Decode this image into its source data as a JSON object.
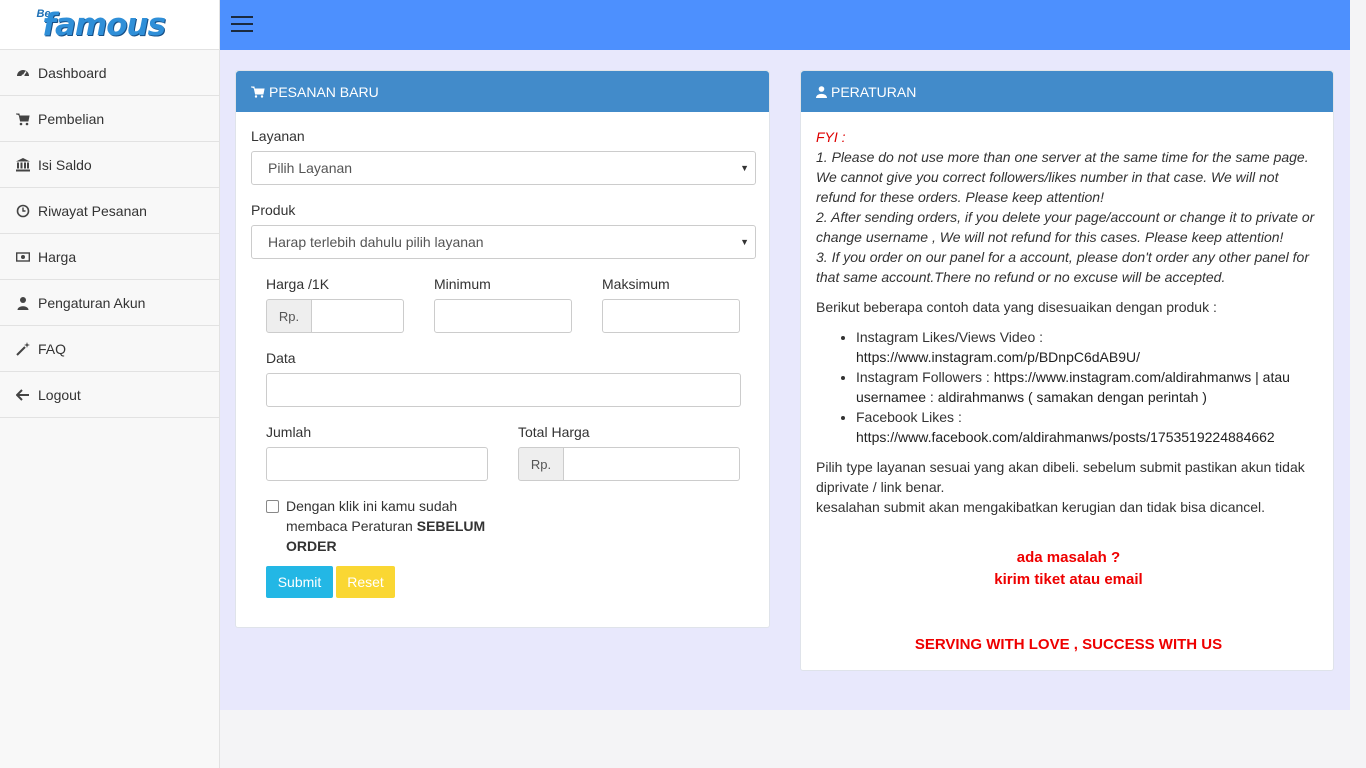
{
  "logo": {
    "small": "Be",
    "main": "famous"
  },
  "sidebar": {
    "items": [
      {
        "label": "Dashboard",
        "icon": "dashboard-icon"
      },
      {
        "label": "Pembelian",
        "icon": "cart-icon"
      },
      {
        "label": "Isi Saldo",
        "icon": "bank-icon"
      },
      {
        "label": "Riwayat Pesanan",
        "icon": "clock-icon"
      },
      {
        "label": "Harga",
        "icon": "money-icon"
      },
      {
        "label": "Pengaturan Akun",
        "icon": "user-icon"
      },
      {
        "label": "FAQ",
        "icon": "magic-wand-icon"
      },
      {
        "label": "Logout",
        "icon": "arrow-left-icon"
      }
    ]
  },
  "order_panel": {
    "title": "PESANAN BARU",
    "layanan_label": "Layanan",
    "layanan_value": "Pilih Layanan",
    "produk_label": "Produk",
    "produk_value": "Harap terlebih dahulu pilih layanan",
    "harga_label": "Harga /1K",
    "currency": "Rp.",
    "minimum_label": "Minimum",
    "maksimum_label": "Maksimum",
    "data_label": "Data",
    "jumlah_label": "Jumlah",
    "total_label": "Total Harga",
    "agree_text_1": "Dengan klik ini kamu sudah membaca Peraturan ",
    "agree_text_bold": "SEBELUM ORDER",
    "submit_label": "Submit",
    "reset_label": "Reset"
  },
  "rules_panel": {
    "title": "PERATURAN",
    "fyi_label": "FYI :",
    "fyi_1": "1. Please do not use more than one server at the same time for the same page. We cannot give you correct followers/likes number in that case. We will not refund for these orders. Please keep attention!",
    "fyi_2": "2. After sending orders, if you delete your page/account or change it to private or change username , We will not refund for this cases. Please keep attention!",
    "fyi_3": "3. If you order on our panel for a account, please don't order any other panel for that same account.There no refund or no excuse will be accepted.",
    "example_intro": "Berikut beberapa contoh data yang disesuaikan dengan produk :",
    "examples": [
      {
        "label": "Instagram Likes/Views Video : ",
        "value": "https://www.instagram.com/p/BDnpC6dAB9U/"
      },
      {
        "label": "Instagram Followers : ",
        "value": "https://www.instagram.com/aldirahmanws | atau usernamee : aldirahmanws ( samakan dengan perintah )"
      },
      {
        "label": "Facebook Likes : ",
        "value": "https://www.facebook.com/aldirahmanws/posts/1753519224884662"
      }
    ],
    "note_1": "Pilih type layanan sesuai yang akan dibeli. sebelum submit pastikan akun tidak diprivate / link benar.",
    "note_2": "kesalahan submit akan mengakibatkan kerugian dan tidak bisa dicancel.",
    "contact_1": "ada masalah ?",
    "contact_2": "kirim tiket atau email",
    "slogan": "SERVING WITH LOVE , SUCCESS WITH US"
  }
}
